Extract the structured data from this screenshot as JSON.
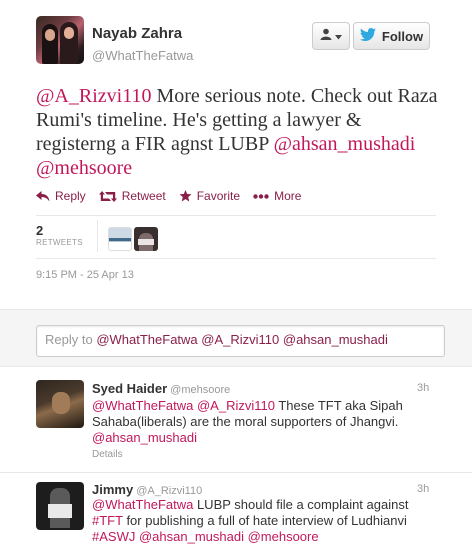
{
  "tweet": {
    "author": {
      "full_name": "Nayab Zahra",
      "username": "@WhatTheFatwa"
    },
    "follow_label": "Follow",
    "text_parts": [
      {
        "type": "mention",
        "text": "@A_Rizvi110"
      },
      {
        "type": "text",
        "text": " More serious note. Check out Raza Rumi's timeline. He's getting a lawyer & registerng a FIR agnst LUBP "
      },
      {
        "type": "mention",
        "text": "@ahsan_mushadi"
      },
      {
        "type": "text",
        "text": " "
      },
      {
        "type": "mention",
        "text": "@mehsoore"
      }
    ],
    "actions": {
      "reply": "Reply",
      "retweet": "Retweet",
      "favorite": "Favorite",
      "more": "More"
    },
    "retweets": {
      "count": "2",
      "label": "RETWEETS"
    },
    "timestamp": "9:15 PM - 25 Apr 13"
  },
  "reply_box": {
    "prefix": "Reply to ",
    "mentions": [
      "@WhatTheFatwa",
      "@A_Rizvi110",
      "@ahsan_mushadi"
    ]
  },
  "replies": [
    {
      "name": "Syed Haider",
      "username": "@mehsoore",
      "time": "3h",
      "text_parts": [
        {
          "type": "mention",
          "text": "@WhatTheFatwa"
        },
        {
          "type": "text",
          "text": " "
        },
        {
          "type": "mention",
          "text": "@A_Rizvi110"
        },
        {
          "type": "text",
          "text": " These TFT aka Sipah Sahaba(liberals) are the moral supporters of Jhangvi. "
        },
        {
          "type": "mention",
          "text": "@ahsan_mushadi"
        }
      ],
      "details_label": "Details"
    },
    {
      "name": "Jimmy",
      "username": "@A_Rizvi110",
      "time": "3h",
      "text_parts": [
        {
          "type": "mention",
          "text": "@WhatTheFatwa"
        },
        {
          "type": "text",
          "text": " LUBP should file a complaint against "
        },
        {
          "type": "mention",
          "text": "#TFT"
        },
        {
          "type": "text",
          "text": " for publishing a full of hate interview of Ludhianvi "
        },
        {
          "type": "mention",
          "text": "#ASWJ"
        },
        {
          "type": "text",
          "text": "  "
        },
        {
          "type": "mention",
          "text": "@ahsan_mushadi"
        },
        {
          "type": "text",
          "text": " "
        },
        {
          "type": "mention",
          "text": "@mehsoore"
        }
      ]
    }
  ],
  "colors": {
    "link": "#c2185b",
    "action": "#8a1f4a",
    "muted": "#999999",
    "twitter_blue": "#2fa9e0"
  }
}
